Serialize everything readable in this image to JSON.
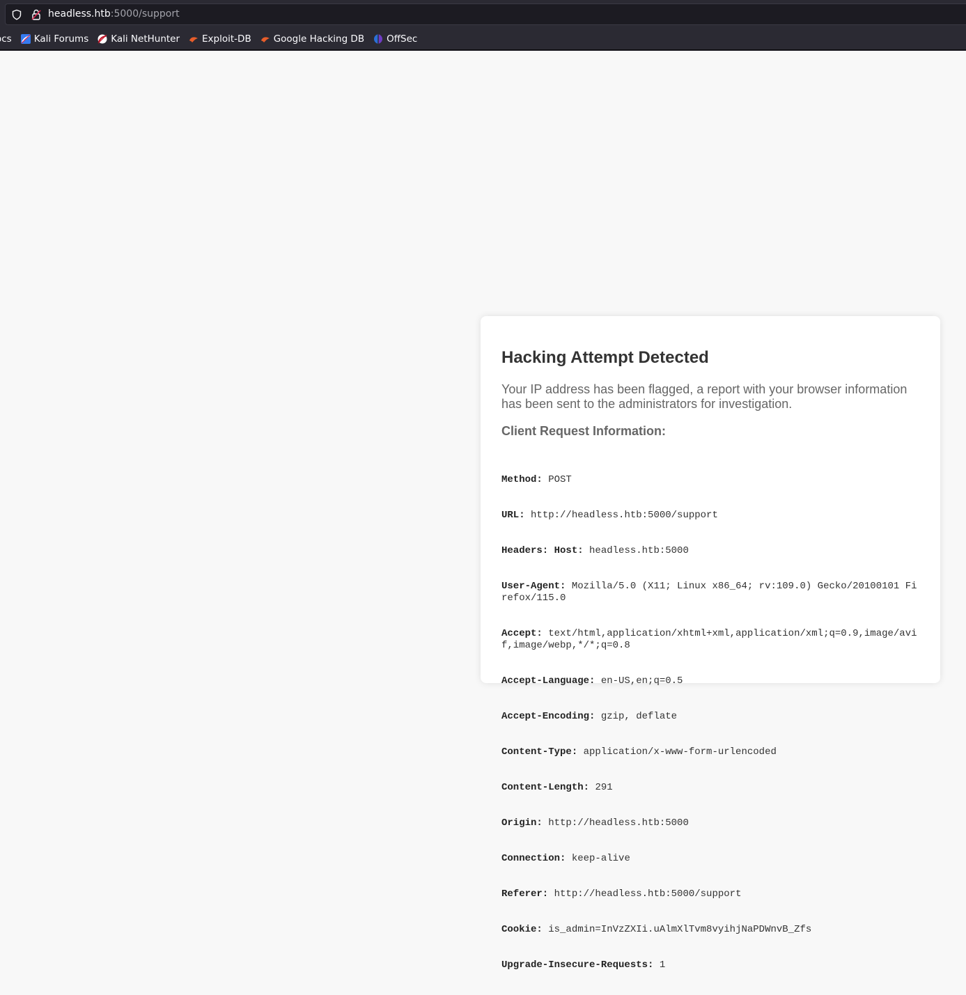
{
  "browser": {
    "url_host": "headless.htb",
    "url_path": ":5000/support",
    "bookmarks": [
      {
        "label": "ocs",
        "icon": "docs-icon"
      },
      {
        "label": "Kali Forums",
        "icon": "kali-forums-icon"
      },
      {
        "label": "Kali NetHunter",
        "icon": "kali-nethunter-icon"
      },
      {
        "label": "Exploit-DB",
        "icon": "exploit-db-icon"
      },
      {
        "label": "Google Hacking DB",
        "icon": "ghdb-icon"
      },
      {
        "label": "OffSec",
        "icon": "offsec-icon"
      }
    ]
  },
  "alert": {
    "title": "Hacking Attempt Detected",
    "message": "Your IP address has been flagged, a report with your browser information has been sent to the administrators for investigation.",
    "subtitle": "Client Request Information:",
    "fields": [
      {
        "key": "Method:",
        "value": "POST"
      },
      {
        "key": "URL:",
        "value": "http://headless.htb:5000/support"
      },
      {
        "key": "Headers: Host:",
        "value": "headless.htb:5000"
      },
      {
        "key": "User-Agent:",
        "value": "Mozilla/5.0 (X11; Linux x86_64; rv:109.0) Gecko/20100101 Firefox/115.0"
      },
      {
        "key": "Accept:",
        "value": "text/html,application/xhtml+xml,application/xml;q=0.9,image/avif,image/webp,*/*;q=0.8"
      },
      {
        "key": "Accept-Language:",
        "value": "en-US,en;q=0.5"
      },
      {
        "key": "Accept-Encoding:",
        "value": "gzip, deflate"
      },
      {
        "key": "Content-Type:",
        "value": "application/x-www-form-urlencoded"
      },
      {
        "key": "Content-Length:",
        "value": "291"
      },
      {
        "key": "Origin:",
        "value": "http://headless.htb:5000"
      },
      {
        "key": "Connection:",
        "value": "keep-alive"
      },
      {
        "key": "Referer:",
        "value": "http://headless.htb:5000/support"
      },
      {
        "key": "Cookie:",
        "value": "is_admin=InVzZXIi.uAlmXlTvm8vyihjNaPDWnvB_Zfs"
      },
      {
        "key": "Upgrade-Insecure-Requests:",
        "value": "1"
      }
    ]
  }
}
